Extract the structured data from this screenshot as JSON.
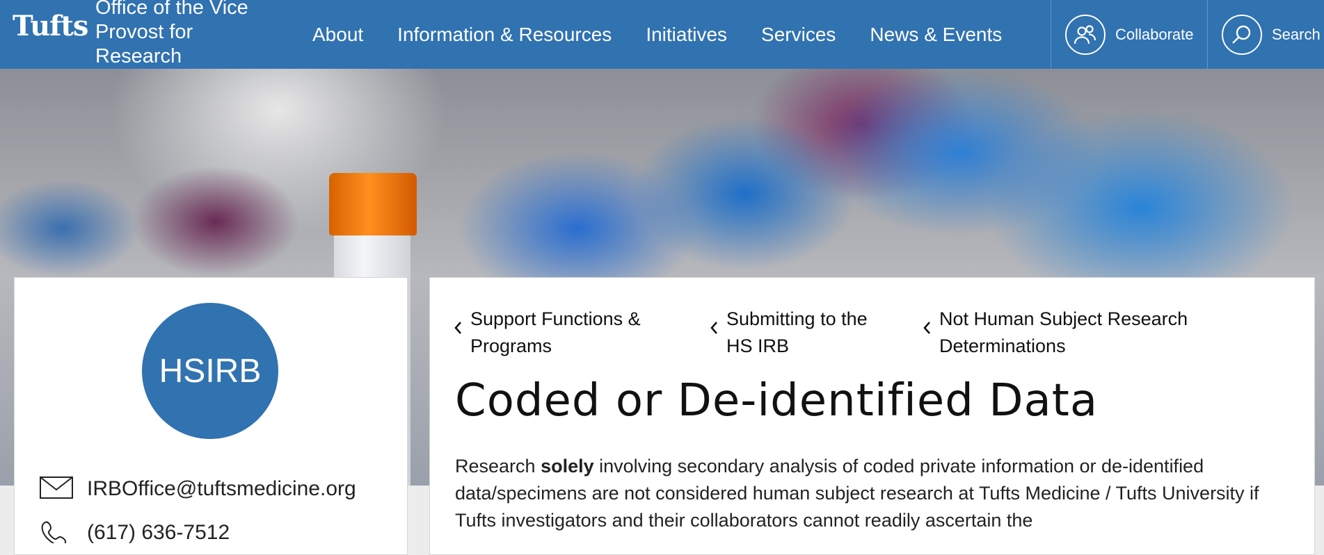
{
  "header": {
    "logo": "Tufts",
    "office_lines": [
      "Office of the Vice",
      "Provost for",
      "Research"
    ],
    "nav": [
      {
        "label": "About"
      },
      {
        "label": "Information & Resources"
      },
      {
        "label": "Initiatives"
      },
      {
        "label": "Services"
      },
      {
        "label": "News & Events"
      }
    ],
    "collaborate": {
      "label": "Collaborate",
      "icon": "people-icon"
    },
    "search": {
      "label": "Search",
      "icon": "search-icon"
    }
  },
  "sidebar": {
    "badge": "HSIRB",
    "email": "IRBOffice@tuftsmedicine.org",
    "phone": "(617) 636-7512"
  },
  "breadcrumbs": [
    {
      "lines": [
        "Support Functions &",
        "Programs"
      ]
    },
    {
      "lines": [
        "Submitting to the",
        "HS IRB"
      ]
    },
    {
      "lines": [
        "Not Human Subject Research",
        "Determinations"
      ]
    }
  ],
  "page": {
    "title": "Coded or De-identified Data",
    "intro_before": "Research ",
    "intro_bold": "solely",
    "intro_after": " involving secondary analysis of coded private information or de-identified data/specimens are not considered human subject research at Tufts Medicine / Tufts University if Tufts investigators and their collaborators cannot readily ascertain the"
  },
  "colors": {
    "brand_blue": "#3172b1",
    "cap_orange": "#ff8f1e"
  }
}
